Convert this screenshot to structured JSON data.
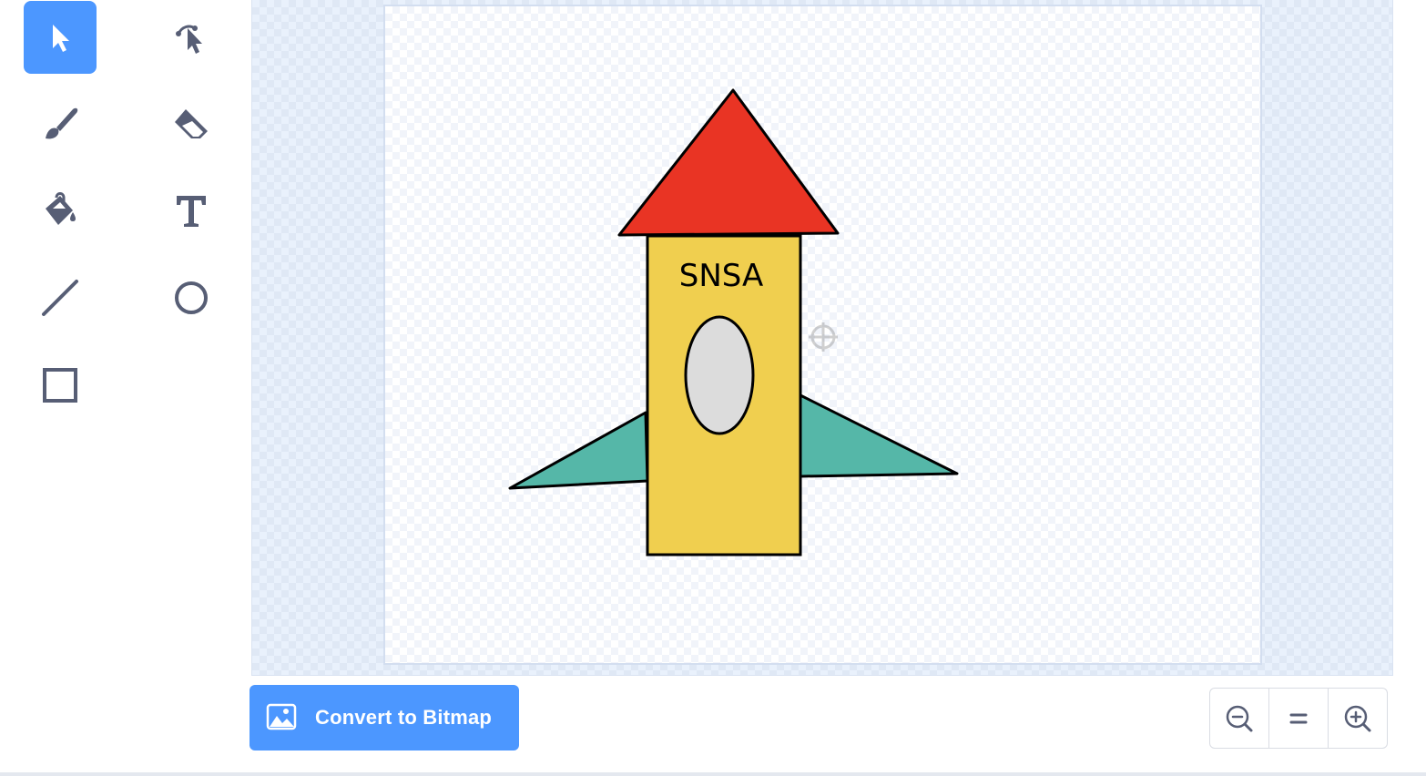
{
  "tools": [
    {
      "name": "select-tool",
      "icon": "arrow-pointer-icon",
      "selected": true
    },
    {
      "name": "reshape-tool",
      "icon": "reshape-pointer-icon",
      "selected": false
    },
    {
      "name": "brush-tool",
      "icon": "paintbrush-icon",
      "selected": false
    },
    {
      "name": "eraser-tool",
      "icon": "eraser-icon",
      "selected": false
    },
    {
      "name": "fill-tool",
      "icon": "paint-bucket-icon",
      "selected": false
    },
    {
      "name": "text-tool",
      "icon": "text-t-icon",
      "selected": false
    },
    {
      "name": "line-tool",
      "icon": "line-icon",
      "selected": false
    },
    {
      "name": "circle-tool",
      "icon": "circle-icon",
      "selected": false
    },
    {
      "name": "rectangle-tool",
      "icon": "square-icon",
      "selected": false
    }
  ],
  "canvas": {
    "drawing_text": "SNSA",
    "crosshair_icon": "center-crosshair-icon"
  },
  "colors": {
    "accent": "#4c97ff",
    "icon_gray": "#575e75",
    "rocket_nose": "#e93424",
    "rocket_body": "#f0cf4f",
    "rocket_fins": "#55b7a8",
    "rocket_window": "#dcdcdc"
  },
  "footer": {
    "convert_label": "Convert to Bitmap",
    "convert_icon": "image-icon",
    "zoom_out_icon": "zoom-out-icon",
    "zoom_reset_icon": "zoom-reset-icon",
    "zoom_in_icon": "zoom-in-icon"
  }
}
